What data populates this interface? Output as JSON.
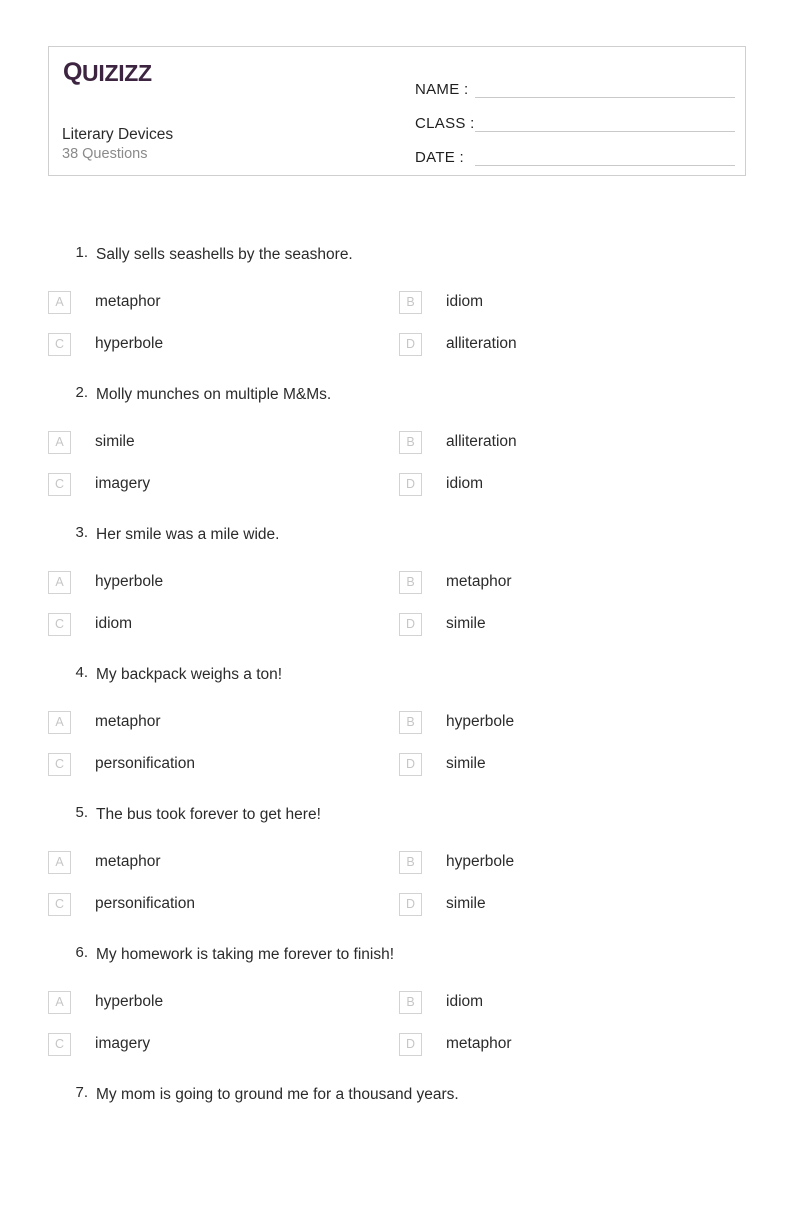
{
  "page": {
    "background_color": "#ffffff",
    "accent_color": "#3d2440"
  },
  "header": {
    "logo": {
      "name": "quizizz-logo",
      "q_mark": "Q",
      "rest": "UIZIZZ",
      "full_text": "Quizizz",
      "color": "#3d2440"
    },
    "quiz_title": "Literary Devices",
    "question_count_label": "38 Questions",
    "fields": [
      {
        "label": "NAME :",
        "value": ""
      },
      {
        "label": "CLASS :",
        "value": ""
      },
      {
        "label": "DATE  :",
        "value": ""
      }
    ]
  },
  "questions": [
    {
      "number": "1.",
      "text": "Sally sells seashells by the seashore.",
      "options": [
        {
          "letter": "A",
          "text": "metaphor"
        },
        {
          "letter": "B",
          "text": "idiom"
        },
        {
          "letter": "C",
          "text": "hyperbole"
        },
        {
          "letter": "D",
          "text": "alliteration"
        }
      ]
    },
    {
      "number": "2.",
      "text": "Molly munches on multiple M&Ms.",
      "options": [
        {
          "letter": "A",
          "text": "simile"
        },
        {
          "letter": "B",
          "text": "alliteration"
        },
        {
          "letter": "C",
          "text": "imagery"
        },
        {
          "letter": "D",
          "text": "idiom"
        }
      ]
    },
    {
      "number": "3.",
      "text": "Her smile was a mile wide.",
      "options": [
        {
          "letter": "A",
          "text": "hyperbole"
        },
        {
          "letter": "B",
          "text": "metaphor"
        },
        {
          "letter": "C",
          "text": "idiom"
        },
        {
          "letter": "D",
          "text": "simile"
        }
      ]
    },
    {
      "number": "4.",
      "text": "My backpack weighs a ton!",
      "options": [
        {
          "letter": "A",
          "text": "metaphor"
        },
        {
          "letter": "B",
          "text": "hyperbole"
        },
        {
          "letter": "C",
          "text": "personification"
        },
        {
          "letter": "D",
          "text": "simile"
        }
      ]
    },
    {
      "number": "5.",
      "text": "The bus took forever to get here!",
      "options": [
        {
          "letter": "A",
          "text": "metaphor"
        },
        {
          "letter": "B",
          "text": "hyperbole"
        },
        {
          "letter": "C",
          "text": "personification"
        },
        {
          "letter": "D",
          "text": "simile"
        }
      ]
    },
    {
      "number": "6.",
      "text": "My homework is taking me forever to finish!",
      "options": [
        {
          "letter": "A",
          "text": "hyperbole"
        },
        {
          "letter": "B",
          "text": "idiom"
        },
        {
          "letter": "C",
          "text": "imagery"
        },
        {
          "letter": "D",
          "text": "metaphor"
        }
      ]
    },
    {
      "number": "7.",
      "text": "My mom is going to ground me for a thousand years.",
      "options": []
    }
  ]
}
